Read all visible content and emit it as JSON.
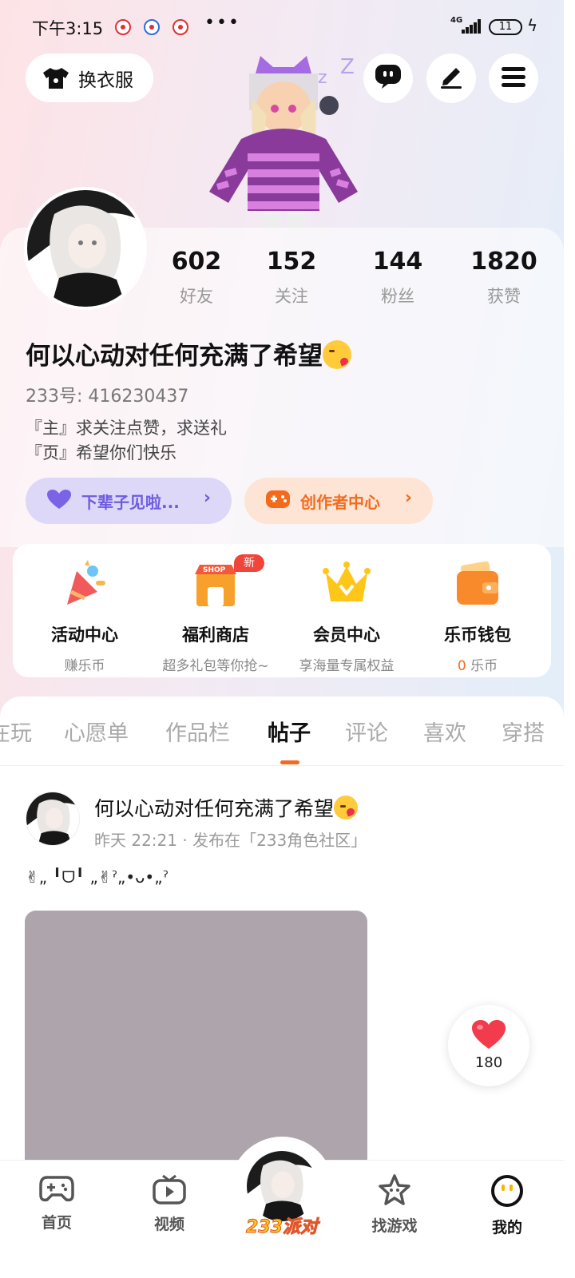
{
  "status_bar": {
    "time": "下午3:15",
    "more": "•••",
    "network": "4G",
    "battery": "11"
  },
  "header": {
    "outfit_label": "换衣服",
    "buttons": [
      "chat-icon",
      "edit-icon",
      "menu-icon"
    ]
  },
  "profile": {
    "stats": [
      {
        "value": "602",
        "label": "好友"
      },
      {
        "value": "152",
        "label": "关注"
      },
      {
        "value": "144",
        "label": "粉丝"
      },
      {
        "value": "1820",
        "label": "获赞"
      }
    ],
    "nickname": "何以心动对任何充满了希望",
    "uid": "233号: 416230437",
    "bio_lines": [
      "『主』求关注点赞，求送礼",
      "『页』希望你们快乐"
    ],
    "pill_status": "下辈子见啦...",
    "pill_creator": "创作者中心"
  },
  "features": [
    {
      "title": "活动中心",
      "subtitle": "赚乐币"
    },
    {
      "title": "福利商店",
      "subtitle": "超多礼包等你抢~",
      "badge": "新"
    },
    {
      "title": "会员中心",
      "subtitle": "享海量专属权益"
    },
    {
      "title": "乐币钱包",
      "subtitle_value": "0",
      "subtitle": "乐币"
    }
  ],
  "tabs": [
    "在玩",
    "心愿单",
    "作品栏",
    "帖子",
    "评论",
    "喜欢",
    "穿搭"
  ],
  "active_tab": "帖子",
  "post": {
    "author": "何以心动对任何充满了希望",
    "meta": "昨天 22:21 · 发布在「233角色社区」",
    "text": "✌︎„ ╹ᗜ╹ „✌︎ˀ„•ᴗ•„ˀ",
    "likes": "180"
  },
  "bottom_nav": [
    {
      "label": "首页"
    },
    {
      "label": "视频"
    },
    {
      "label": "233派对"
    },
    {
      "label": "找游戏"
    },
    {
      "label": "我的"
    }
  ],
  "colors": {
    "accent": "#f26b1d",
    "purple": "#6f5ce0",
    "like": "#f23b4c"
  }
}
